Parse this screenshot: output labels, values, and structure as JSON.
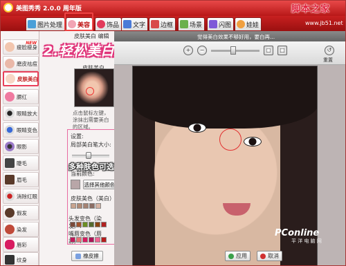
{
  "window": {
    "title": "美图秀秀 2.0.0 周年版",
    "watermark": "脚本之家",
    "site_url": "www.jb51.net"
  },
  "tabs": [
    {
      "label": "图片处理",
      "icon": "image-icon"
    },
    {
      "label": "美容",
      "icon": "face-icon",
      "active": true
    },
    {
      "label": "饰品",
      "icon": "heart-icon"
    },
    {
      "label": "文字",
      "icon": "text-icon"
    },
    {
      "label": "边框",
      "icon": "frame-icon"
    },
    {
      "label": "场景",
      "icon": "scene-icon"
    },
    {
      "label": "闪图",
      "icon": "flash-icon"
    },
    {
      "label": "娃娃",
      "icon": "doll-icon"
    }
  ],
  "sidebar": {
    "items": [
      {
        "label": "瘦脸瘦身",
        "icon": "slim-face-icon",
        "badge": "NEW"
      },
      {
        "label": "磨皮祛痘",
        "icon": "smooth-skin-icon"
      },
      {
        "label": "皮肤美白",
        "icon": "whiten-skin-icon",
        "active": true
      },
      {
        "label": "腮红",
        "icon": "blush-icon"
      },
      {
        "label": "眼睛放大",
        "icon": "eye-enlarge-icon"
      },
      {
        "label": "眼睛变色",
        "icon": "eye-color-icon"
      },
      {
        "label": "眼影",
        "icon": "eyeshadow-icon"
      },
      {
        "label": "睫毛",
        "icon": "eyelash-icon"
      },
      {
        "label": "眉毛",
        "icon": "eyebrow-icon"
      },
      {
        "label": "消除红眼",
        "icon": "redeye-icon"
      },
      {
        "label": "假发",
        "icon": "wig-icon"
      },
      {
        "label": "染发",
        "icon": "hair-dye-icon"
      },
      {
        "label": "唇彩",
        "icon": "lipstick-icon"
      },
      {
        "label": "纹身",
        "icon": "tattoo-icon"
      }
    ]
  },
  "panel": {
    "title": "皮肤美白 编辑",
    "subtitle": "皮肤美白",
    "annotation_title": "2.轻松美白皮肤",
    "description": "点击鼠标左键，涂抹出需要美白的区域。",
    "settings_label": "设置:",
    "brush_size_label": "局部美白笔大小:",
    "brush_min_label": "小",
    "current_color_label": "当前颜色:",
    "choose_color_button": "选择其他颜色",
    "annotation_skin": "多种肤色可选哦",
    "skin_color_label": "皮肤美色（美白）:",
    "skin_swatches": [
      "#c9a48f",
      "#b28b76",
      "#a58273",
      "#8d6e65",
      "#d7b3a3"
    ],
    "hair_color_label": "头发变色（染发）:",
    "hair_swatches": [
      "#7b4a3a",
      "#a0522d",
      "#6b8e23",
      "#556b2f",
      "#8b4513",
      "#b22222"
    ],
    "lip_color_label": "嘴唇变色（唇彩）:",
    "lip_swatches": [
      "#c2185b",
      "#e57373",
      "#d81b60",
      "#ad1457",
      "#f06292",
      "#b71c1c"
    ],
    "eraser_button": "橡皮擦"
  },
  "image_area": {
    "hint": "觉得美白效果不够好用，要白再...",
    "reset_label": "重置",
    "apply_button": "应用",
    "cancel_button": "取消",
    "photo_watermark": "PConline",
    "photo_watermark_sub": "平 洋 电 脑 网"
  },
  "colors": {
    "brand": "#c81e1e",
    "highlight": "#e9405a"
  }
}
